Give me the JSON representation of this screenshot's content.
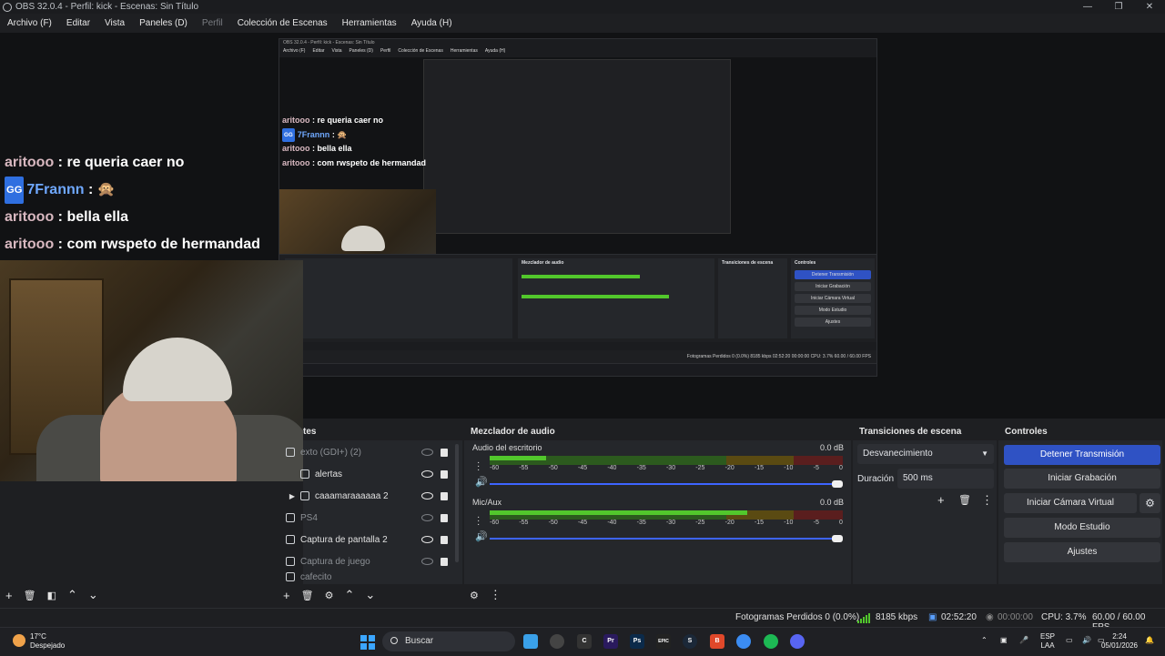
{
  "window": {
    "title": "OBS 32.0.4 - Perfil: kick - Escenas: Sin Título",
    "controls": [
      "—",
      "❐",
      "✕"
    ]
  },
  "menu": [
    {
      "label": "Archivo (F)",
      "enabled": true
    },
    {
      "label": "Editar",
      "enabled": true
    },
    {
      "label": "Vista",
      "enabled": true
    },
    {
      "label": "Paneles (D)",
      "enabled": true
    },
    {
      "label": "Perfil",
      "enabled": false
    },
    {
      "label": "Colección de Escenas",
      "enabled": true
    },
    {
      "label": "Herramientas",
      "enabled": true
    },
    {
      "label": "Ayuda (H)",
      "enabled": true
    }
  ],
  "chat": [
    {
      "user": "aritooo",
      "message": "re queria caer no",
      "badge": false
    },
    {
      "user": "7Frannn",
      "message": "🙊",
      "badge": true,
      "badge_text": "GG"
    },
    {
      "user": "aritooo",
      "message": "bella ella",
      "badge": false
    },
    {
      "user": "aritooo",
      "message": "com rwspeto de hermandad",
      "badge": false
    }
  ],
  "nested": {
    "title": "OBS 32.0.4 - Perfil: kick - Escenas: Sin Título",
    "menu": [
      "Archivo (F)",
      "Editar",
      "Vista",
      "Paneles (D)",
      "Perfil",
      "Colección de Escenas",
      "Herramientas",
      "Ayuda (H)"
    ],
    "mixer_title": "Mezclador de audio",
    "transitions_title": "Transiciones de escena",
    "controls_title": "Controles",
    "buttons": [
      "Detener Transmisión",
      "Iniciar Grabación",
      "Iniciar Cámara Virtual",
      "Modo Estudio",
      "Ajustes"
    ],
    "status": "Fotogramas Perdidos 0 (0.0%)   8185 kbps   02:52:20   00:00:00   CPU: 3.7%   60.00 / 60.00 FPS"
  },
  "sources": {
    "title": "tes",
    "items": [
      {
        "name": "exto (GDI+) (2)",
        "icon": "text-icon",
        "visible": false,
        "dim": true,
        "group": false
      },
      {
        "name": "alertas",
        "icon": "folder-icon",
        "visible": true,
        "dim": false,
        "group": false
      },
      {
        "name": "caaamaraaaaaa 2",
        "icon": "folder-icon",
        "visible": true,
        "dim": false,
        "group": true
      },
      {
        "name": "PS4",
        "icon": "camera-icon",
        "visible": false,
        "dim": true,
        "group": false
      },
      {
        "name": "Captura de pantalla 2",
        "icon": "monitor-icon",
        "visible": true,
        "dim": false,
        "group": false
      },
      {
        "name": "Captura de juego",
        "icon": "gamepad-icon",
        "visible": false,
        "dim": true,
        "group": false
      },
      {
        "name": "cafecito",
        "icon": "image-icon",
        "visible": false,
        "dim": true,
        "group": false
      }
    ]
  },
  "mixer": {
    "title": "Mezclador de audio",
    "scale": [
      "-60",
      "-55",
      "-50",
      "-45",
      "-40",
      "-35",
      "-30",
      "-25",
      "-20",
      "-15",
      "-10",
      "-5",
      "0"
    ],
    "tracks": [
      {
        "name": "Audio del escritorio",
        "db": "0.0 dB",
        "level": 0.16
      },
      {
        "name": "Mic/Aux",
        "db": "0.0 dB",
        "level": 0.73
      }
    ]
  },
  "transitions": {
    "title": "Transiciones de escena",
    "selected": "Desvanecimiento",
    "duration_label": "Duración",
    "duration_value": "500 ms"
  },
  "controls": {
    "title": "Controles",
    "stream": "Detener Transmisión",
    "record": "Iniciar Grabación",
    "virtual_cam": "Iniciar Cámara Virtual",
    "studio": "Modo Estudio",
    "settings": "Ajustes"
  },
  "status": {
    "dropped": "Fotogramas Perdidos 0 (0.0%)",
    "bitrate": "8185 kbps",
    "stream_time": "02:52:20",
    "record_time": "00:00:00",
    "cpu": "CPU: 3.7%",
    "fps": "60.00 / 60.00 FPS"
  },
  "taskbar": {
    "temp": "17°C",
    "weather": "Despejado",
    "search": "Buscar",
    "lang1": "ESP",
    "lang2": "LAA",
    "time": "2:24",
    "date": "05/01/2026",
    "apps": [
      {
        "name": "explorer-icon",
        "label": "",
        "color": "#3aa0e8"
      },
      {
        "name": "obs-icon",
        "label": "",
        "color": "#444"
      },
      {
        "name": "cursor-icon",
        "label": "C",
        "color": "#333"
      },
      {
        "name": "premiere-icon",
        "label": "Pr",
        "color": "#2a1a5e"
      },
      {
        "name": "photoshop-icon",
        "label": "Ps",
        "color": "#0b2a4a"
      },
      {
        "name": "epic-icon",
        "label": "EPIC",
        "color": "#222"
      },
      {
        "name": "steam-icon",
        "label": "S",
        "color": "#1b2838"
      },
      {
        "name": "brave-icon",
        "label": "B",
        "color": "#e0482a"
      },
      {
        "name": "chrome-icon",
        "label": "",
        "color": "#3b8cf2"
      },
      {
        "name": "spotify-icon",
        "label": "",
        "color": "#1db954"
      },
      {
        "name": "discord-icon",
        "label": "",
        "color": "#5865f2"
      }
    ]
  }
}
